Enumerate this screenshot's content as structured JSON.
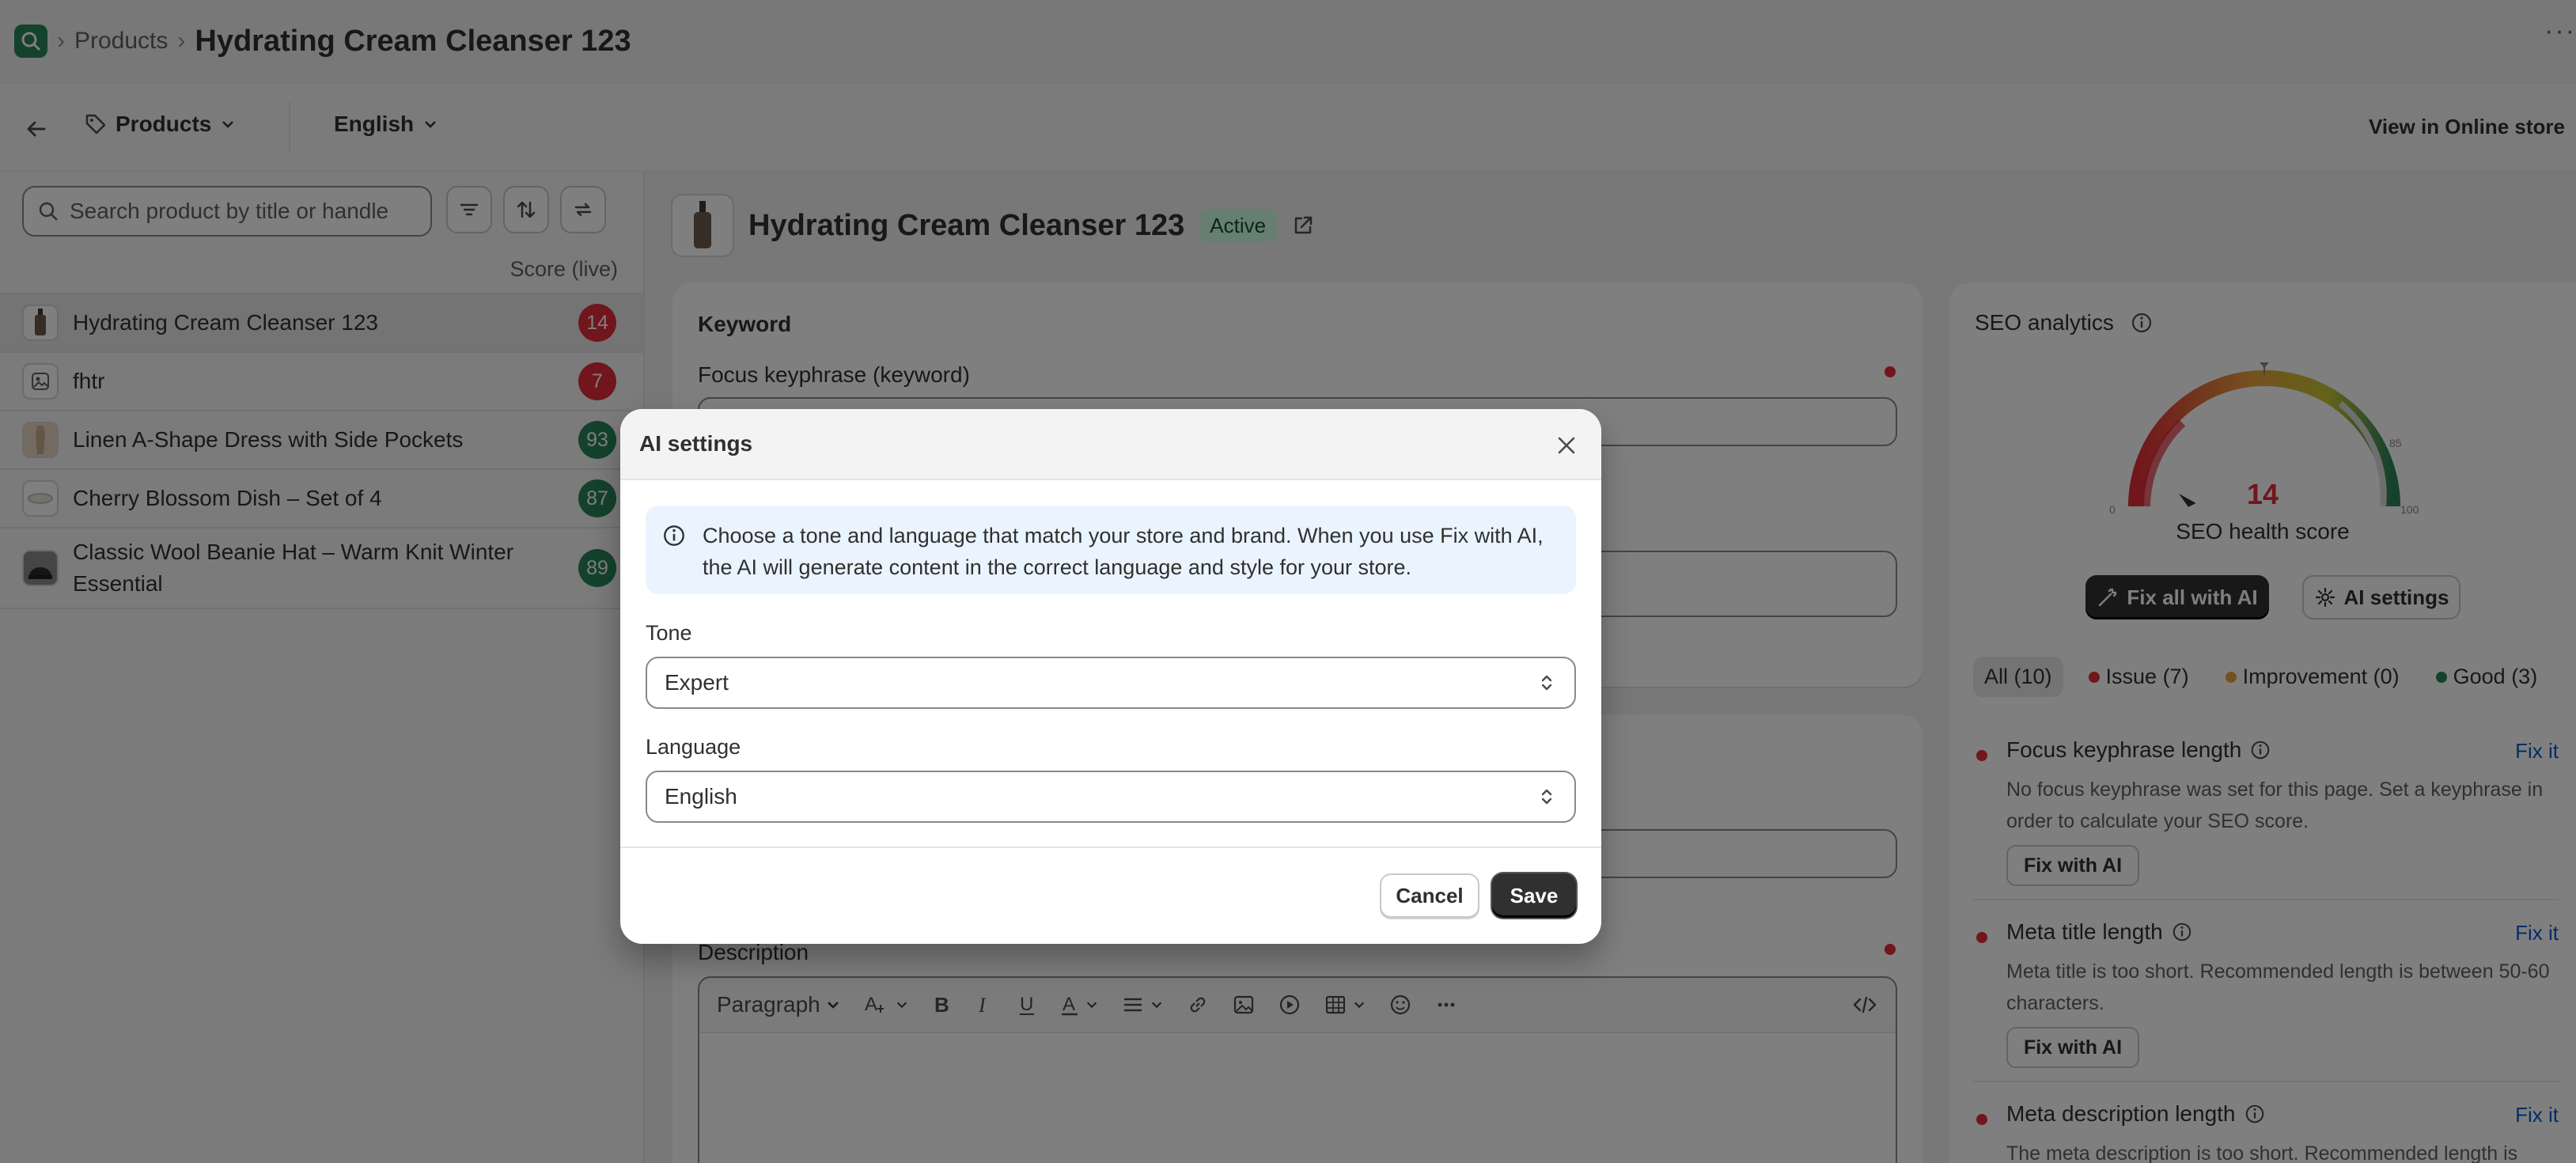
{
  "breadcrumb": {
    "root": "Products",
    "current": "Hydrating Cream Cleanser 123"
  },
  "toolbar": {
    "resource_select": "Products",
    "language_select": "English",
    "view_online": "View in Online store"
  },
  "search": {
    "placeholder": "Search product by title or handle"
  },
  "list": {
    "score_header": "Score (live)",
    "items": [
      {
        "name": "Hydrating Cream Cleanser 123",
        "score": "14"
      },
      {
        "name": "fhtr",
        "score": "7"
      },
      {
        "name": "Linen A-Shape Dress with Side Pockets",
        "score": "93"
      },
      {
        "name": "Cherry Blossom Dish – Set of 4",
        "score": "87"
      },
      {
        "name": "Classic Wool Beanie Hat – Warm Knit Winter Essential",
        "score": "89"
      }
    ]
  },
  "product": {
    "title": "Hydrating Cream Cleanser 123",
    "status": "Active"
  },
  "keyword_card": {
    "heading": "Keyword",
    "focus_label": "Focus keyphrase (keyword)"
  },
  "description": {
    "label": "Description",
    "toolbar_paragraph": "Paragraph"
  },
  "seo": {
    "heading": "SEO analytics",
    "score": "14",
    "score_label": "SEO health score",
    "gauge_ticks": {
      "min": "0",
      "max": "100",
      "good": "85"
    },
    "fix_all": "Fix all with AI",
    "ai_settings": "AI settings",
    "filters": [
      {
        "label": "All (10)"
      },
      {
        "label": "Issue (7)",
        "color": "#e22c38"
      },
      {
        "label": "Improvement (0)",
        "color": "#e8a33d"
      },
      {
        "label": "Good (3)",
        "color": "#29845a"
      }
    ],
    "issues": [
      {
        "title": "Focus keyphrase length",
        "fix": "Fix it",
        "desc": "No focus keyphrase was set for this page. Set a keyphrase in order to calculate your SEO score.",
        "button": "Fix with AI"
      },
      {
        "title": "Meta title length",
        "fix": "Fix it",
        "desc": "Meta title is too short. Recommended length is between 50-60 characters.",
        "button": "Fix with AI"
      },
      {
        "title": "Meta description length",
        "fix": "Fix it",
        "desc": "The meta description is too short. Recommended length is"
      }
    ]
  },
  "modal": {
    "title": "AI settings",
    "banner": "Choose a tone and language that match your store and brand. When you use Fix with AI, the AI will generate content in the correct language and style for your store.",
    "tone_label": "Tone",
    "tone_value": "Expert",
    "language_label": "Language",
    "language_value": "English",
    "cancel": "Cancel",
    "save": "Save"
  },
  "colors": {
    "accent_red": "#e22c38",
    "accent_green": "#29845a",
    "link_blue": "#005bd3",
    "dark_button": "#303030"
  }
}
